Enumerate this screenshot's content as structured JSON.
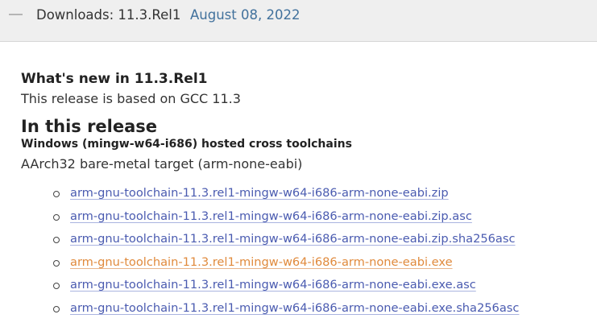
{
  "header": {
    "title": "Downloads: 11.3.Rel1",
    "date": "August 08, 2022"
  },
  "content": {
    "whats_new": "What's new in 11.3.Rel1",
    "based_on": "This release is based on GCC 11.3",
    "in_release": "In this release",
    "hosted": "Windows (mingw-w64-i686) hosted cross toolchains",
    "target": "AArch32 bare-metal target (arm-none-eabi)",
    "files": [
      "arm-gnu-toolchain-11.3.rel1-mingw-w64-i686-arm-none-eabi.zip",
      "arm-gnu-toolchain-11.3.rel1-mingw-w64-i686-arm-none-eabi.zip.asc",
      "arm-gnu-toolchain-11.3.rel1-mingw-w64-i686-arm-none-eabi.zip.sha256asc",
      "arm-gnu-toolchain-11.3.rel1-mingw-w64-i686-arm-none-eabi.exe",
      "arm-gnu-toolchain-11.3.rel1-mingw-w64-i686-arm-none-eabi.exe.asc",
      "arm-gnu-toolchain-11.3.rel1-mingw-w64-i686-arm-none-eabi.exe.sha256asc"
    ]
  },
  "colors": {
    "link": "#4a5bb0",
    "link_hover": "#e08a3c",
    "date": "#41719c",
    "header_bg": "#efefef"
  }
}
